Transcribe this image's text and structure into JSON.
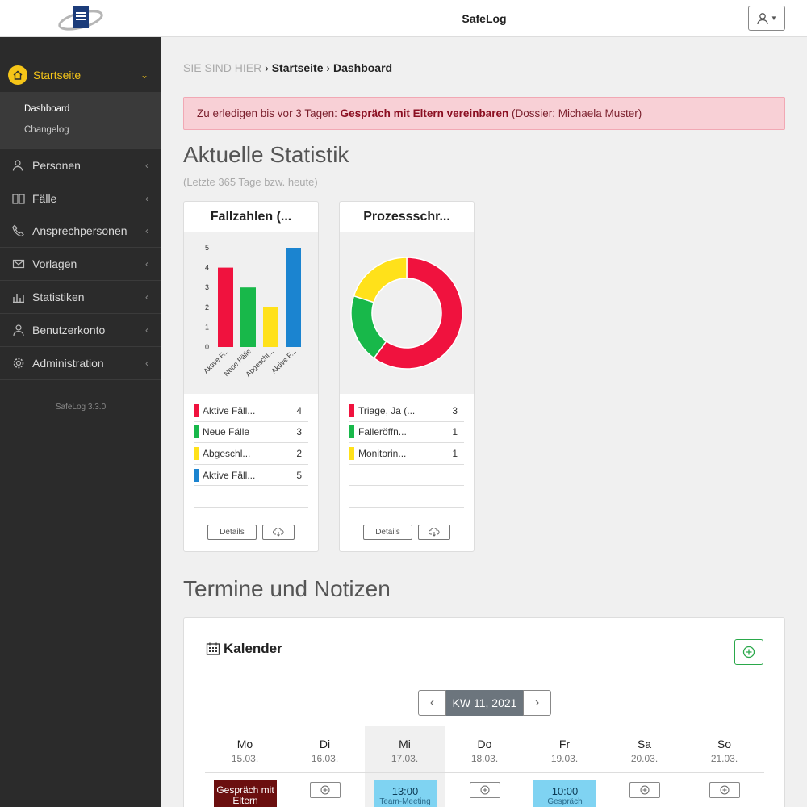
{
  "app": {
    "title": "SafeLog",
    "version": "SafeLog 3.3.0"
  },
  "sidebar": {
    "active": {
      "label": "Startseite",
      "sub": [
        "Dashboard",
        "Changelog"
      ]
    },
    "items": [
      {
        "label": "Personen",
        "icon": "persons-icon"
      },
      {
        "label": "Fälle",
        "icon": "book-icon"
      },
      {
        "label": "Ansprechpersonen",
        "icon": "phone-icon"
      },
      {
        "label": "Vorlagen",
        "icon": "envelope-icon"
      },
      {
        "label": "Statistiken",
        "icon": "bar-chart-icon"
      },
      {
        "label": "Benutzerkonto",
        "icon": "user-icon"
      },
      {
        "label": "Administration",
        "icon": "gear-icon"
      }
    ]
  },
  "breadcrumb": {
    "prefix": "SIE SIND HIER",
    "items": [
      "Startseite",
      "Dashboard"
    ]
  },
  "alert": {
    "prefix": "Zu erledigen bis vor 3 Tagen:",
    "task": "Gespräch mit Eltern vereinbaren",
    "suffix": "(Dossier: Michaela Muster)"
  },
  "stats": {
    "heading": "Aktuelle Statistik",
    "subheading": "(Letzte 365 Tage bzw. heute)"
  },
  "chart_data": [
    {
      "type": "bar",
      "title": "Fallzahlen (...",
      "categories": [
        "Aktive F...",
        "Neue Fälle",
        "Abgeschl...",
        "Aktive F..."
      ],
      "values": [
        4,
        3,
        2,
        5
      ],
      "colors": [
        "#f0123e",
        "#18b84a",
        "#ffe11a",
        "#1b84d0"
      ],
      "ylim": [
        0,
        5
      ],
      "yticks": [
        "0",
        "1",
        "2",
        "3",
        "4",
        "5"
      ],
      "legend": [
        {
          "label": "Aktive Fäll...",
          "value": "4"
        },
        {
          "label": "Neue Fälle",
          "value": "3"
        },
        {
          "label": "Abgeschl...",
          "value": "2"
        },
        {
          "label": "Aktive Fäll...",
          "value": "5"
        }
      ]
    },
    {
      "type": "pie",
      "title": "Prozessschr...",
      "values": [
        3,
        1,
        1
      ],
      "colors": [
        "#f0123e",
        "#18b84a",
        "#ffe11a"
      ],
      "legend": [
        {
          "label": "Triage, Ja (...",
          "value": "3"
        },
        {
          "label": "Falleröffn...",
          "value": "1"
        },
        {
          "label": "Monitorin...",
          "value": "1"
        }
      ]
    }
  ],
  "card_actions": {
    "details": "Details"
  },
  "notes": {
    "heading": "Termine und Notizen"
  },
  "calendar": {
    "title": "Kalender",
    "week": "KW 11, 2021",
    "days": [
      {
        "name": "Mo",
        "date": "15.03.",
        "event": {
          "kind": "dark",
          "text": "Gespräch mit Eltern"
        }
      },
      {
        "name": "Di",
        "date": "16.03."
      },
      {
        "name": "Mi",
        "date": "17.03.",
        "today": true,
        "event": {
          "kind": "blue",
          "time": "13:00",
          "text": "Team-Meeting"
        }
      },
      {
        "name": "Do",
        "date": "18.03."
      },
      {
        "name": "Fr",
        "date": "19.03.",
        "event": {
          "kind": "blue",
          "time": "10:00",
          "text": "Gespräch"
        }
      },
      {
        "name": "Sa",
        "date": "20.03."
      },
      {
        "name": "So",
        "date": "21.03."
      }
    ]
  }
}
